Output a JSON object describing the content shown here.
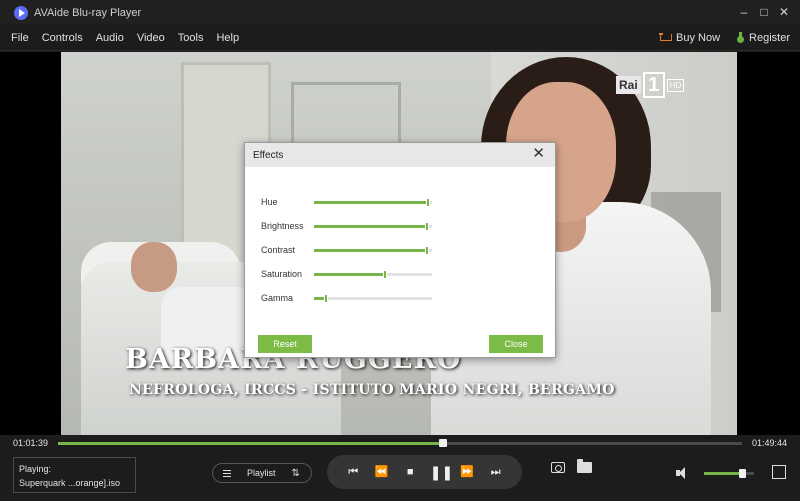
{
  "window": {
    "title": "AVAide Blu-ray Player",
    "minimize_glyph": "–",
    "maximize_glyph": "□",
    "close_glyph": "✕"
  },
  "menu": {
    "items": [
      "File",
      "Controls",
      "Audio",
      "Video",
      "Tools",
      "Help"
    ],
    "buy_now": "Buy Now",
    "register": "Register"
  },
  "video": {
    "channel_logo": "Rai",
    "channel_number": "1",
    "channel_badge": "HD",
    "caption_name": "BARBARA RUGGERO",
    "caption_subtitle": "NEFROLOGA, IRCCS - ISTITUTO MARIO NEGRI, BERGAMO"
  },
  "effects_dialog": {
    "title": "Effects",
    "close_glyph": "✕",
    "sliders": [
      {
        "label": "Hue",
        "value": 0.97
      },
      {
        "label": "Brightness",
        "value": 0.96
      },
      {
        "label": "Contrast",
        "value": 0.96
      },
      {
        "label": "Saturation",
        "value": 0.6
      },
      {
        "label": "Gamma",
        "value": 0.1
      }
    ],
    "reset_label": "Reset",
    "close_label": "Close"
  },
  "playback": {
    "elapsed": "01:01:39",
    "duration": "01:49:44",
    "progress": 0.563,
    "volume": 0.75
  },
  "now_playing": {
    "label": "Playing:",
    "file": "Superquark ...orange].iso"
  },
  "playlist": {
    "label": "Playlist",
    "sort_glyph": "⇅"
  },
  "transport": {
    "prev_glyph": "⏮",
    "rewind_glyph": "⏪",
    "stop_glyph": "■",
    "pause_glyph": "❚❚",
    "forward_glyph": "⏩",
    "next_glyph": "⏭"
  },
  "colors": {
    "accent": "#77b548",
    "window_bg": "#1c1c1c",
    "buy_icon": "#e07c2c"
  },
  "icons": [
    "app-logo-icon",
    "cart-icon",
    "register-icon",
    "playlist-menu-icon",
    "sort-icon",
    "camera-icon",
    "folder-icon",
    "volume-icon",
    "fullscreen-icon"
  ]
}
